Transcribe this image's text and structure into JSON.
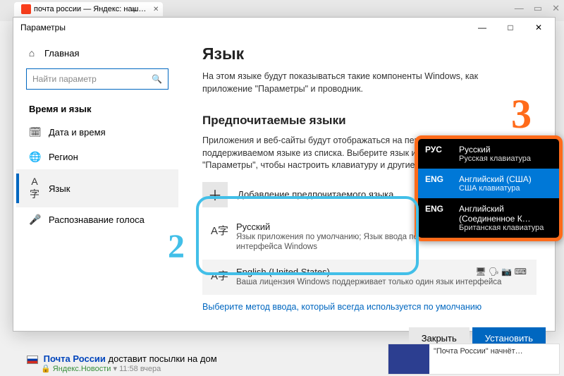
{
  "browser": {
    "tab_title": "почта россии — Яндекс: наш…",
    "new_tab_glyph": "+",
    "ctrl_min": "—",
    "ctrl_max": "▭",
    "ctrl_close": "✕"
  },
  "window": {
    "title": "Параметры",
    "min": "—",
    "max": "□",
    "close": "✕"
  },
  "sidebar": {
    "home": "Главная",
    "search_placeholder": "Найти параметр",
    "section": "Время и язык",
    "items": [
      {
        "icon": "🗓",
        "label": "Дата и время"
      },
      {
        "icon": "🌐",
        "label": "Регион"
      },
      {
        "icon": "A字",
        "label": "Язык"
      },
      {
        "icon": "🎤",
        "label": "Распознавание голоса"
      }
    ]
  },
  "main": {
    "h1": "Язык",
    "desc": "На этом языке будут показываться такие компоненты Windows, как приложение \"Параметры\" и проводник.",
    "h2": "Предпочитаемые языки",
    "desc2": "Приложения и веб-сайты будут отображаться на первом поддерживаемом языке из списка. Выберите язык и нажмите кнопку \"Параметры\", чтобы настроить клавиатуру и другие возможности.",
    "add_label": "Добавление предпочитаемого языка",
    "plus": "＋",
    "langs": [
      {
        "name": "Русский",
        "sub": "Язык приложения по умолчанию; Язык ввода по умолчанию; Язык интерфейса Windows",
        "icons": "A⁺ 🗣 📷 ⌨"
      },
      {
        "name": "English (United States)",
        "sub": "Ваша лицензия Windows поддерживает только один язык интерфейса",
        "icons": "🖥 🗣 📷 ⌨"
      }
    ],
    "link": "Выберите метод ввода, который всегда используется по умолчанию"
  },
  "popup": {
    "rows": [
      {
        "code": "РУС",
        "name": "Русский",
        "sub": "Русская клавиатура",
        "selected": false
      },
      {
        "code": "ENG",
        "name": "Английский (США)",
        "sub": "США клавиатура",
        "selected": true
      },
      {
        "code": "ENG",
        "name": "Английский (Соединенное К…",
        "sub": "Британская клавиатура",
        "selected": false
      }
    ]
  },
  "annotations": {
    "two": "2",
    "three": "3"
  },
  "footer": {
    "close": "Закрыть",
    "install": "Установить",
    "result_title": "Почта России",
    "result_rest": " доставит посылки на дом",
    "result_source": "Яндекс.Новости",
    "result_time": "11:58 вчера",
    "snippet": "\"Почта России\" начнёт…"
  }
}
